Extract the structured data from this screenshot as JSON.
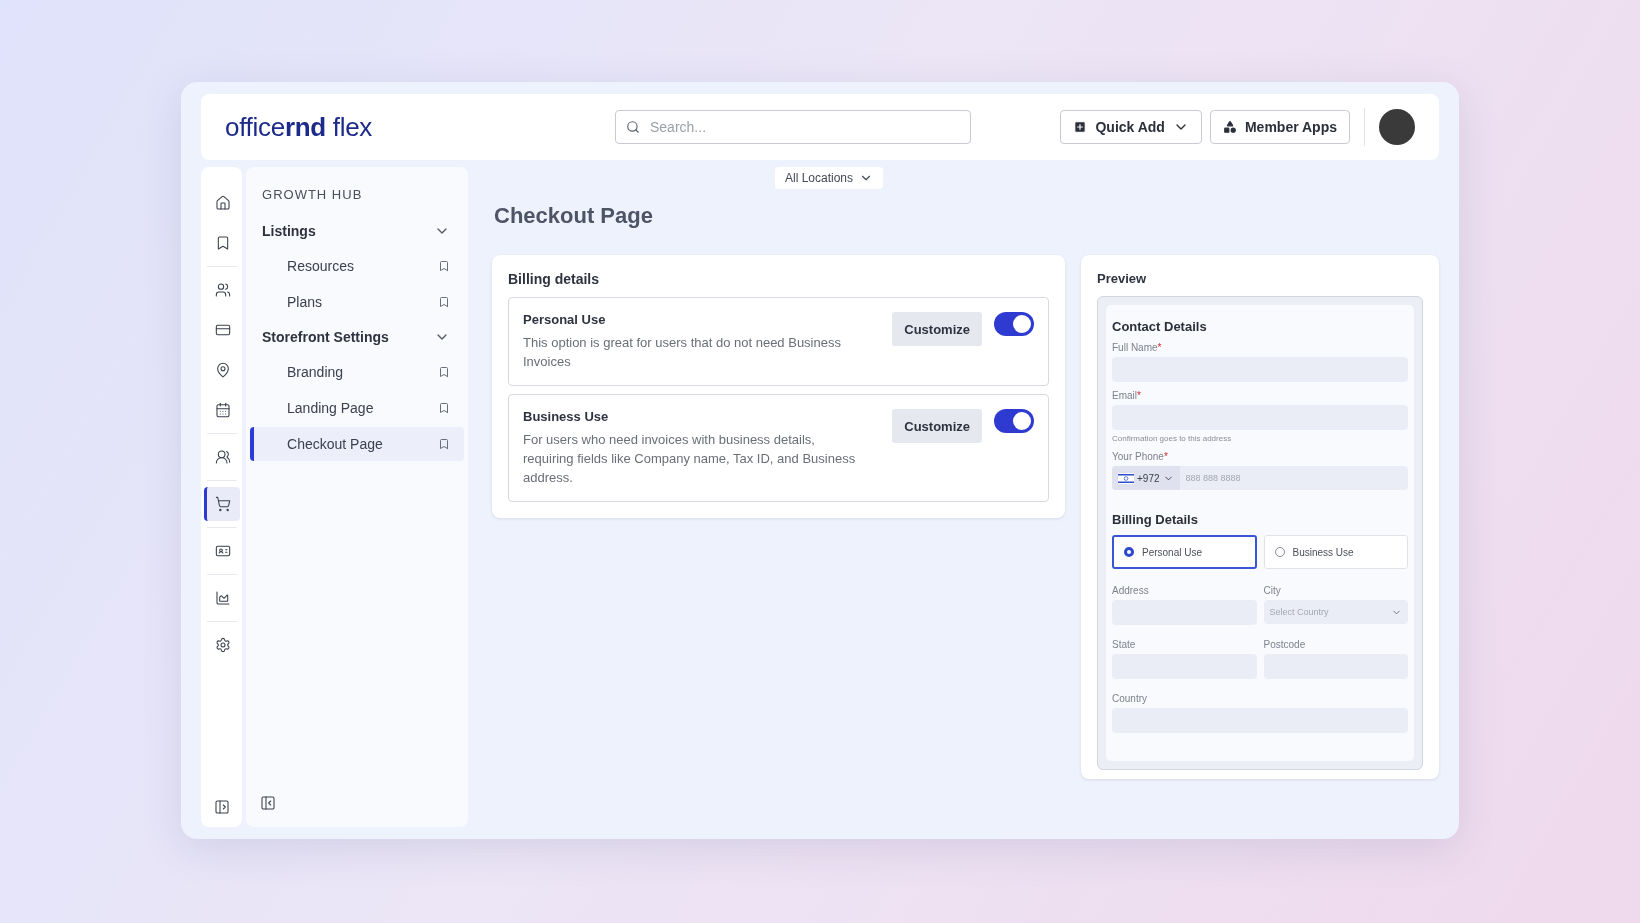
{
  "header": {
    "logo": "office**rnd** flex",
    "search": {
      "placeholder": "Search..."
    },
    "buttons": [
      {
        "kind": "quick",
        "label": "Quick Add"
      },
      {
        "kind": "apps",
        "label": "Member Apps"
      }
    ]
  },
  "location_filter": "All Locations",
  "rail": [
    {
      "selected": false
    },
    {
      "selected": false
    },
    {
      "selected": false
    },
    {
      "selected": false
    },
    {
      "selected": false
    },
    {
      "selected": false
    },
    {
      "selected": false
    },
    {
      "selected": true
    },
    {
      "selected": false
    },
    {
      "selected": false
    },
    {
      "selected": false
    }
  ],
  "sidebar": {
    "title": "GROWTH HUB",
    "groups": [
      {
        "label": "Listings",
        "expanded": true,
        "children": [
          {
            "label": "Resources",
            "selected": false
          },
          {
            "label": "Plans",
            "selected": false
          }
        ]
      },
      {
        "label": "Storefront Settings",
        "expanded": true,
        "children": [
          {
            "label": "Branding",
            "selected": false
          },
          {
            "label": "Landing Page",
            "selected": false
          },
          {
            "label": "Checkout Page",
            "selected": true
          }
        ]
      }
    ]
  },
  "page_title": "Checkout Page",
  "billing": {
    "title": "Billing details",
    "options": [
      {
        "title": "Personal Use",
        "description": "This option is great for users that do not need Business Invoices",
        "button": "Customize",
        "on": true
      },
      {
        "title": "Business Use",
        "description": "For users who need invoices with business details, requiring fields like Company name, Tax ID, and Business address.",
        "button": "Customize",
        "on": true
      }
    ]
  },
  "preview": {
    "title": "Preview",
    "contact": {
      "title": "Contact Details",
      "fields": [
        {
          "label": "Full Name",
          "required_mark": "*"
        },
        {
          "label": "Email",
          "required_mark": "*",
          "hint": "Confirmation goes to this address"
        }
      ],
      "phone": {
        "label": "Your Phone",
        "required_mark": "*",
        "code": "+972",
        "placeholder": "888 888 8888"
      }
    },
    "billing": {
      "title": "Billing Details",
      "choices": [
        {
          "label": "Personal Use",
          "selected": true
        },
        {
          "label": "Business Use",
          "selected": false
        }
      ],
      "fields": [
        {
          "label": "Address",
          "kind": "text"
        },
        {
          "label": "City",
          "kind": "select",
          "placeholder": "Select Country"
        },
        {
          "label": "State",
          "kind": "text"
        },
        {
          "label": "Postcode",
          "kind": "text"
        },
        {
          "label": "Country",
          "kind": "wide"
        }
      ]
    }
  }
}
